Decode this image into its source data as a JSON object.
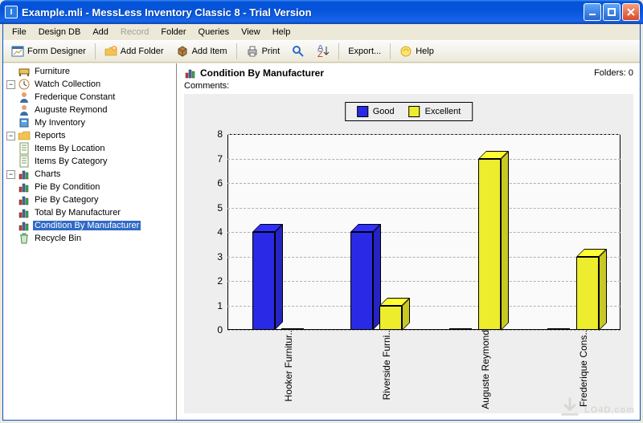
{
  "titlebar": {
    "title": "Example.mli - MessLess Inventory Classic 8 - Trial Version"
  },
  "menubar": [
    "File",
    "Design DB",
    "Add",
    "Record",
    "Folder",
    "Queries",
    "View",
    "Help"
  ],
  "menubar_disabled_index": 3,
  "toolbar": {
    "form_designer": "Form Designer",
    "add_folder": "Add Folder",
    "add_item": "Add Item",
    "print": "Print",
    "export": "Export...",
    "help": "Help"
  },
  "tree": {
    "furniture": "Furniture",
    "watch_collection": "Watch Collection",
    "frederique_constant": "Frederique Constant",
    "auguste_reymond": "Auguste Reymond",
    "my_inventory": "My Inventory",
    "reports": "Reports",
    "items_by_location": "Items By Location",
    "items_by_category": "Items By Category",
    "charts": "Charts",
    "pie_by_condition": "Pie By Condition",
    "pie_by_category": "Pie By Category",
    "total_by_manufacturer": "Total By Manufacturer",
    "condition_by_manufacturer": "Condition By Manufacturer",
    "recycle_bin": "Recycle Bin"
  },
  "content_header": {
    "title": "Condition By Manufacturer",
    "folders_label": "Folders: 0",
    "comments_label": "Comments:"
  },
  "legend": {
    "good": "Good",
    "excellent": "Excellent"
  },
  "watermark": "LO4D.com",
  "colors": {
    "good": "#2a2ae6",
    "excellent": "#eded2d"
  },
  "chart_data": {
    "type": "bar",
    "categories": [
      "Hooker Furnitur..",
      "Riverside Furni..",
      "Auguste Reymond",
      "Frederique Cons.."
    ],
    "series": [
      {
        "name": "Good",
        "values": [
          4,
          4,
          0,
          0
        ]
      },
      {
        "name": "Excellent",
        "values": [
          0,
          1,
          7,
          3
        ]
      }
    ],
    "ylim": [
      0,
      8
    ],
    "yticks": [
      0,
      1,
      2,
      3,
      4,
      5,
      6,
      7,
      8
    ],
    "title": "Condition By Manufacturer",
    "xlabel": "",
    "ylabel": ""
  }
}
